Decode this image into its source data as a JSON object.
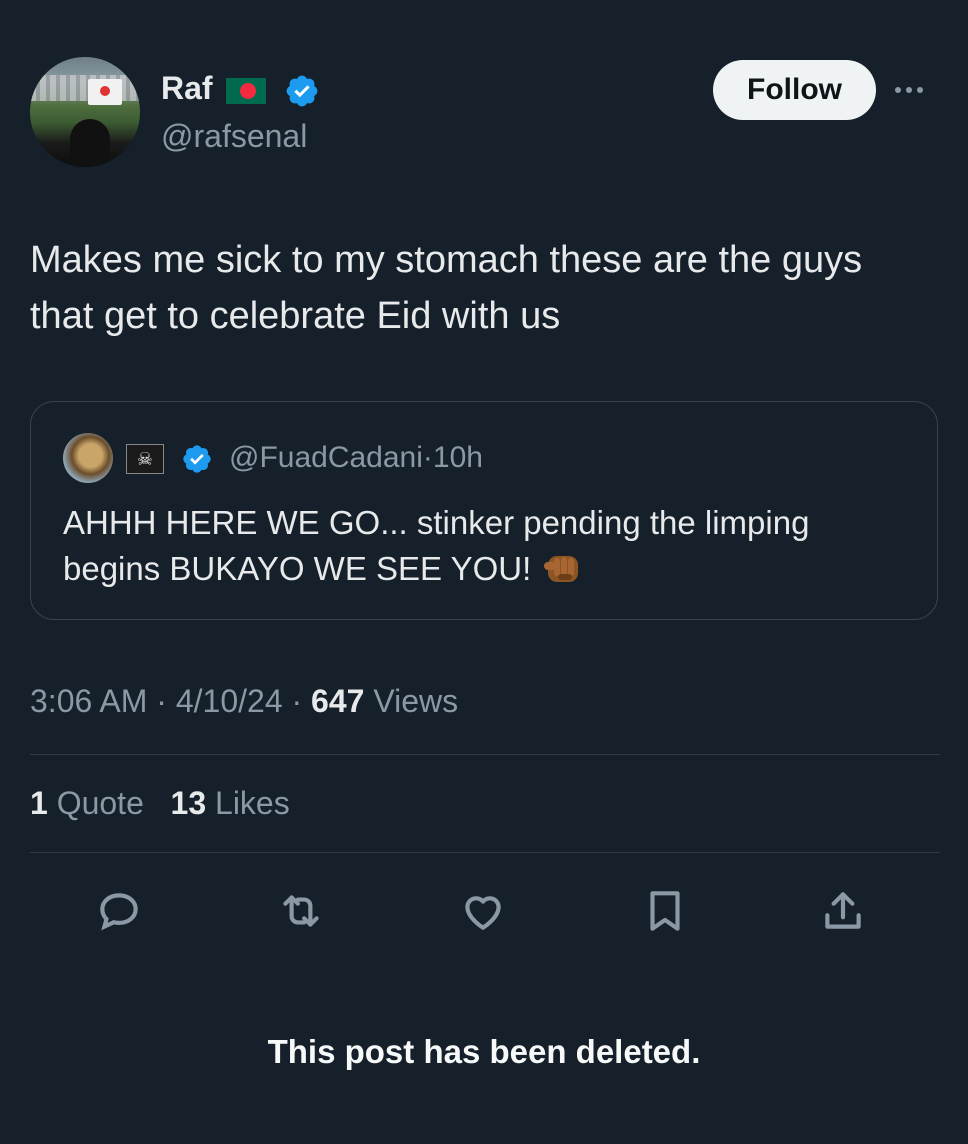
{
  "author": {
    "display_name": "Raf",
    "flag_icon": "bangladesh-flag-icon",
    "verified_icon": "verified-badge-icon",
    "handle": "@rafsenal"
  },
  "follow_button": {
    "label": "Follow"
  },
  "more_icon": "more-options-icon",
  "tweet": {
    "text": "Makes me sick to my stomach these are the guys that get to celebrate Eid with us"
  },
  "quoted_tweet": {
    "handle": "@FuadCadani",
    "separator": "·",
    "time": "10h",
    "flag_glyph": "☠",
    "text": "AHHH HERE WE GO... stinker pending the limping begins BUKAYO WE SEE YOU!",
    "emoji_icon": "pointing-fist-emoji"
  },
  "meta": {
    "time": "3:06 AM",
    "sep1": "·",
    "date": "4/10/24",
    "sep2": "·",
    "views_count": "647",
    "views_label": "Views"
  },
  "stats": {
    "quotes_count": "1",
    "quotes_label": "Quote",
    "likes_count": "13",
    "likes_label": "Likes"
  },
  "actions": [
    "reply-icon",
    "retweet-icon",
    "like-icon",
    "bookmark-icon",
    "share-icon"
  ],
  "notice": "This post has been deleted.",
  "colors": {
    "background": "#15202b",
    "text": "#e7e9ea",
    "secondary": "#8b98a5",
    "verified": "#1d9bf0"
  }
}
